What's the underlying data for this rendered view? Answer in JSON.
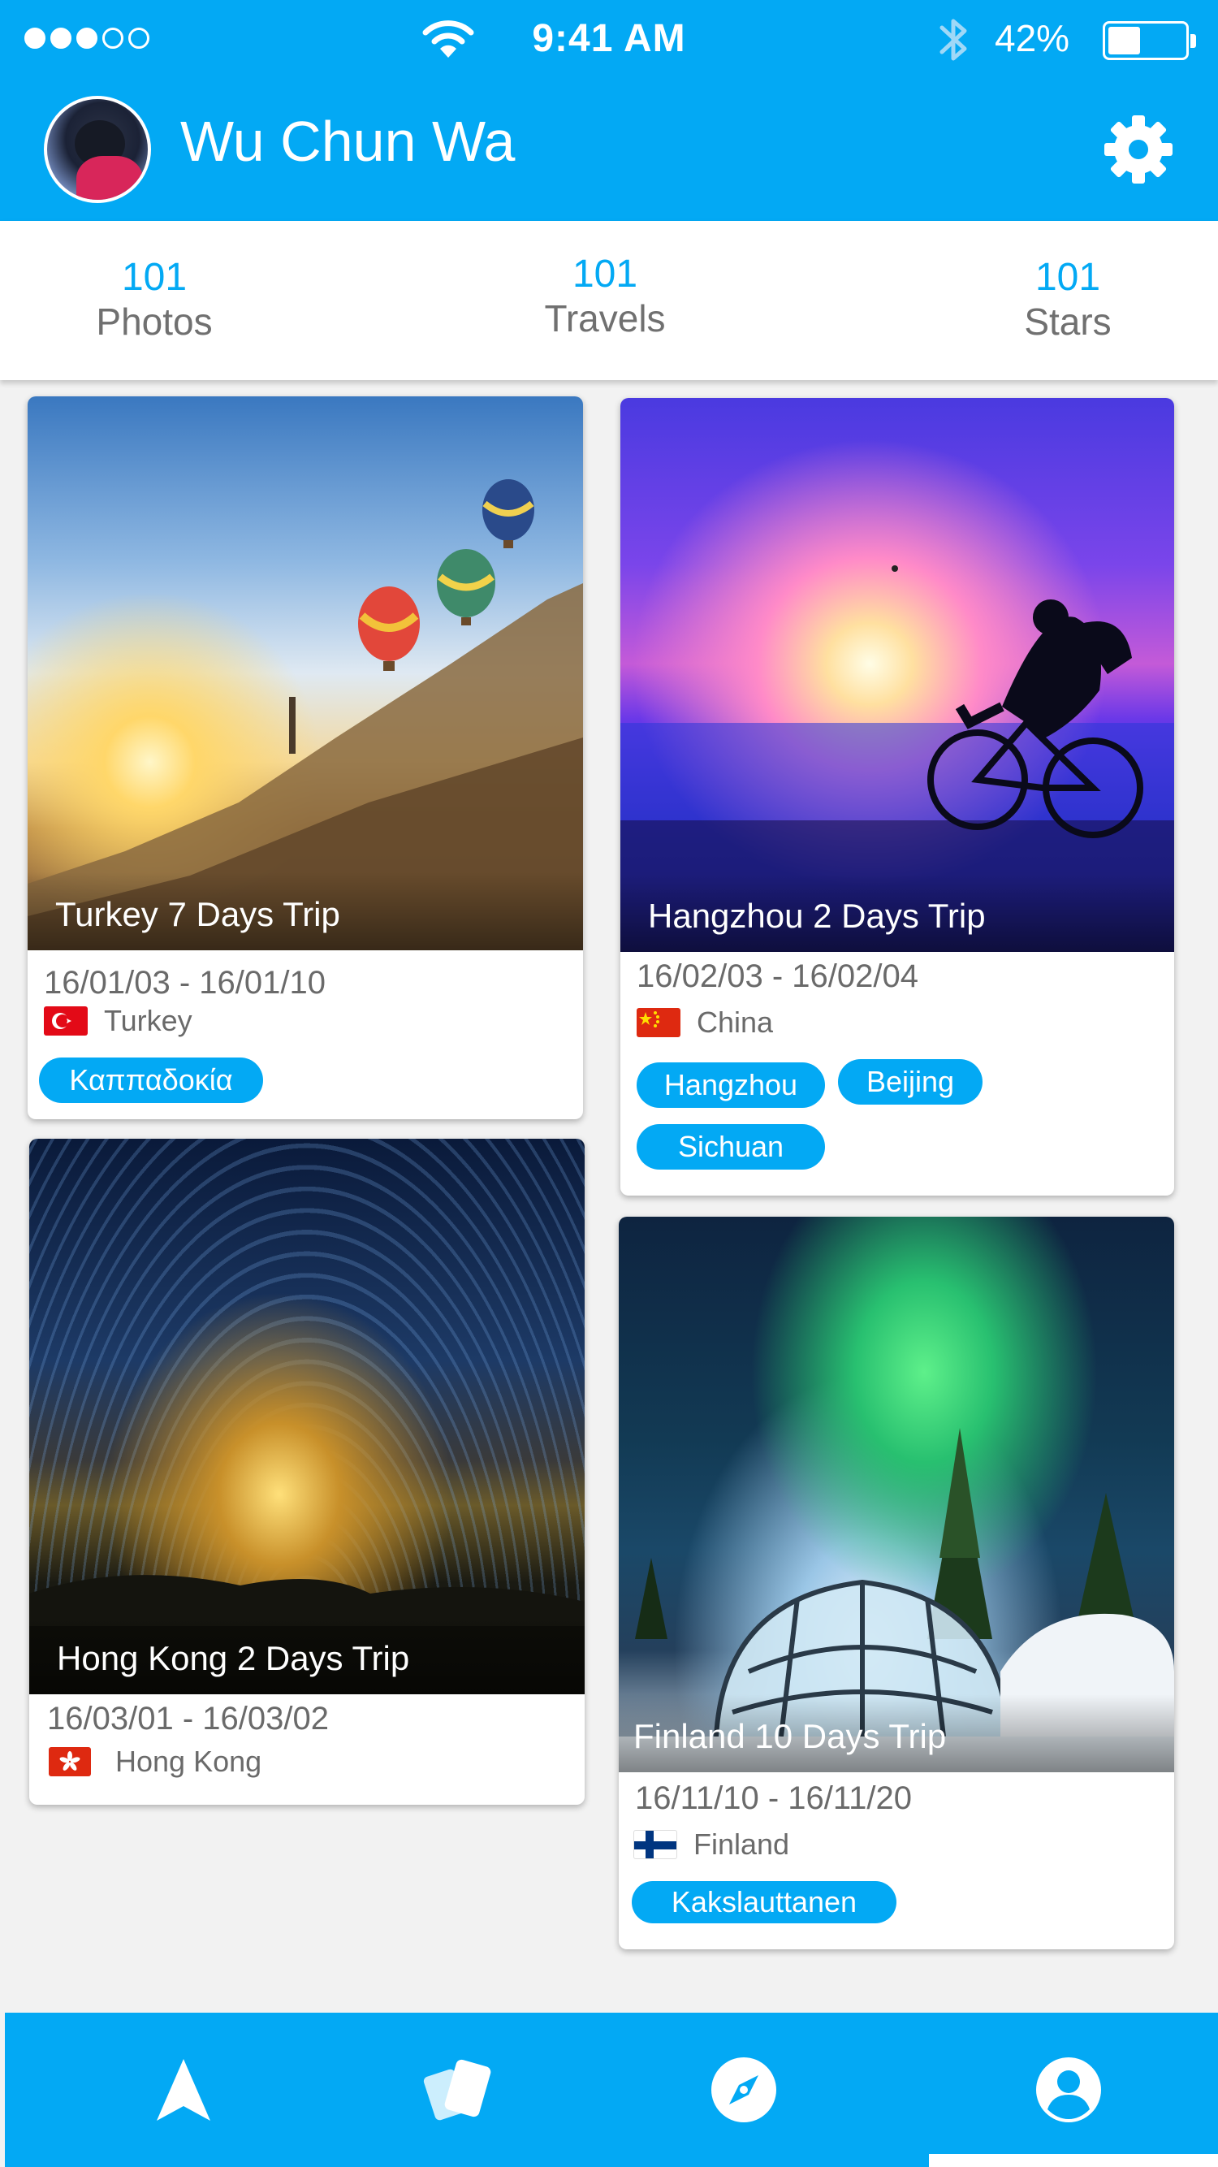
{
  "status_bar": {
    "time": "9:41 AM",
    "battery_percent": "42%",
    "battery_level": 0.42,
    "signal_bars_filled": 3,
    "signal_bars_total": 5,
    "icons": [
      "wifi-icon",
      "bluetooth-icon",
      "battery-icon"
    ]
  },
  "header": {
    "user_name": "Wu Chun Wa",
    "settings_icon": "gear-icon"
  },
  "stats": [
    {
      "value": "101",
      "label": "Photos"
    },
    {
      "value": "101",
      "label": "Travels"
    },
    {
      "value": "101",
      "label": "Stars"
    }
  ],
  "trips": [
    {
      "title": "Turkey 7 Days Trip",
      "dates": "16/01/03 - 16/01/10",
      "country": "Turkey",
      "flag": "flag-turkey-icon",
      "tags": [
        "Καππαδοκία"
      ]
    },
    {
      "title": "Hangzhou 2 Days Trip",
      "dates": "16/02/03 - 16/02/04",
      "country": "China",
      "flag": "flag-china-icon",
      "tags": [
        "Hangzhou",
        "Beijing",
        "Sichuan"
      ]
    },
    {
      "title": "Hong Kong 2 Days Trip",
      "dates": "16/03/01 - 16/03/02",
      "country": "Hong Kong",
      "flag": "flag-hongkong-icon",
      "tags": []
    },
    {
      "title": "Finland 10 Days Trip",
      "dates": "16/11/10 - 16/11/20",
      "country": "Finland",
      "flag": "flag-finland-icon",
      "tags": [
        "Kakslauttanen"
      ]
    }
  ],
  "nav": {
    "items": [
      "navigation-arrow-icon",
      "cards-icon",
      "compass-icon",
      "profile-icon"
    ],
    "active_index": 3
  },
  "colors": {
    "primary": "#03A9F4",
    "background": "#f2f2f2",
    "text_muted": "#707070"
  }
}
